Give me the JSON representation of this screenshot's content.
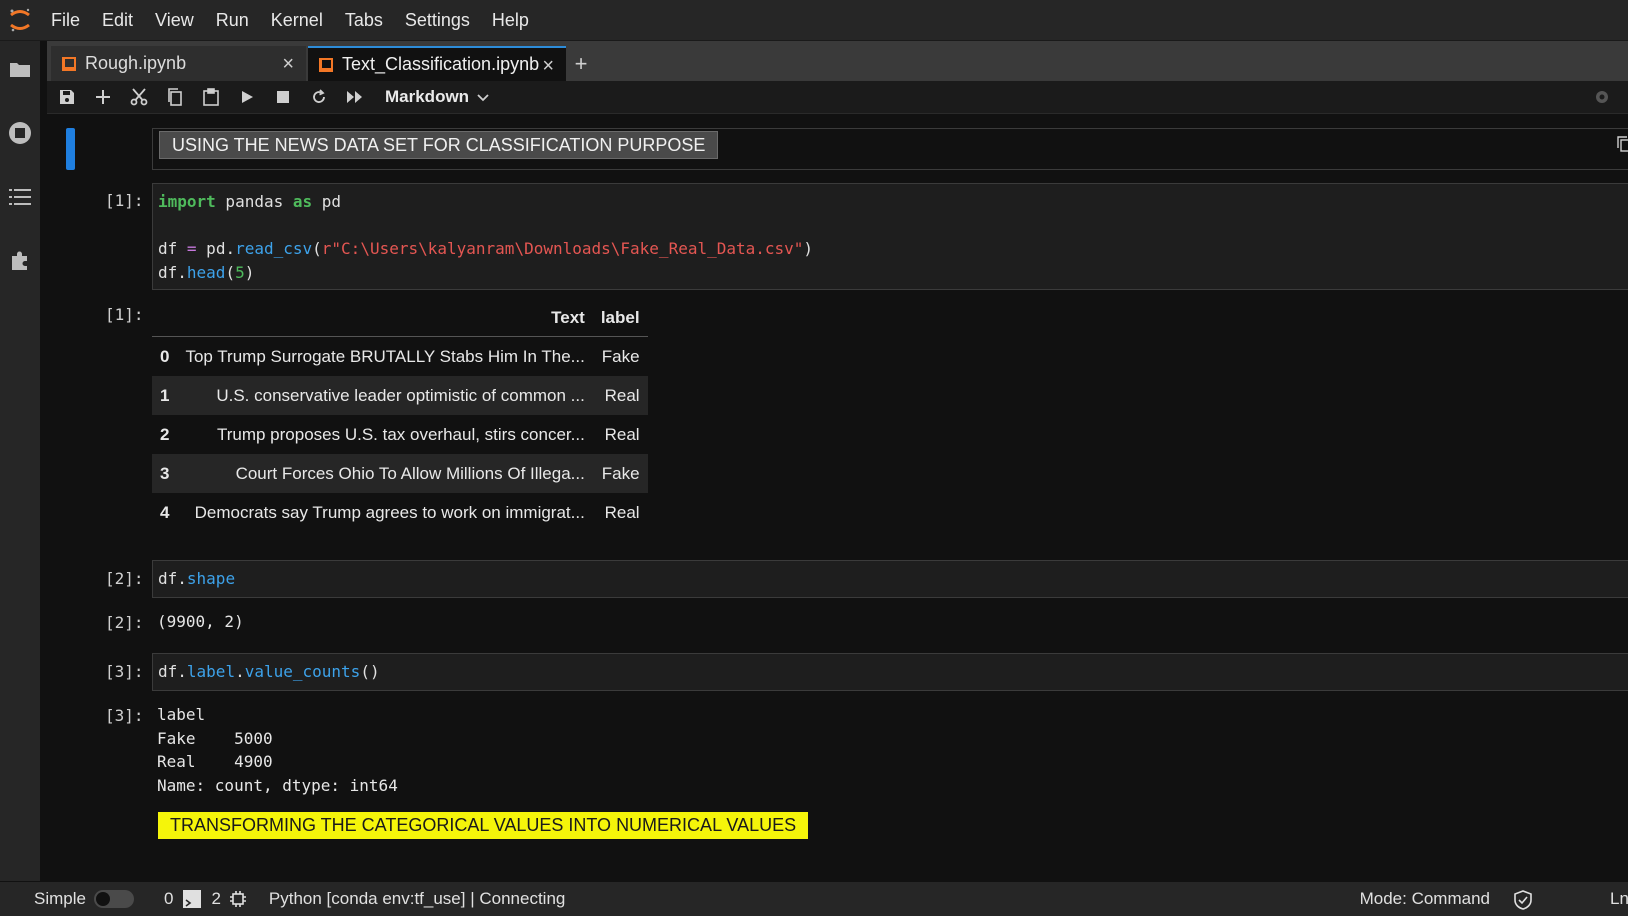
{
  "menu": [
    "File",
    "Edit",
    "View",
    "Run",
    "Kernel",
    "Tabs",
    "Settings",
    "Help"
  ],
  "tabs": [
    {
      "label": "Rough.ipynb",
      "active": false
    },
    {
      "label": "Text_Classification.ipynb",
      "active": true
    }
  ],
  "toolbar": {
    "cell_type": "Markdown"
  },
  "cells": {
    "md1": {
      "text": "USING THE NEWS DATA SET FOR CLASSIFICATION PURPOSE"
    },
    "c1": {
      "in_prompt": "[1]:",
      "out_prompt": "[1]:"
    },
    "c2": {
      "in_prompt": "[2]:",
      "out_prompt": "[2]:",
      "output": "(9900, 2)"
    },
    "c3": {
      "in_prompt": "[3]:",
      "out_prompt": "[3]:",
      "output": "label\nFake    5000\nReal    4900\nName: count, dtype: int64"
    },
    "md2": {
      "text": "TRANSFORMING THE CATEGORICAL VALUES INTO NUMERICAL VALUES"
    }
  },
  "dataframe": {
    "columns": [
      "",
      "Text",
      "label"
    ],
    "rows": [
      [
        "0",
        "Top Trump Surrogate BRUTALLY Stabs Him In The...",
        "Fake"
      ],
      [
        "1",
        "U.S. conservative leader optimistic of common ...",
        "Real"
      ],
      [
        "2",
        "Trump proposes U.S. tax overhaul, stirs concer...",
        "Real"
      ],
      [
        "3",
        "Court Forces Ohio To Allow Millions Of Illega...",
        "Fake"
      ],
      [
        "4",
        "Democrats say Trump agrees to work on immigrat...",
        "Real"
      ]
    ]
  },
  "status": {
    "simple_label": "Simple",
    "count1": "0",
    "count2": "2",
    "kernel": "Python [conda env:tf_use] | Connecting",
    "mode": "Mode: Command",
    "ln": "Ln"
  },
  "colors": {
    "accent": "#1f7fe0",
    "highlight": "#f5f50a",
    "brand": "#f37726"
  }
}
